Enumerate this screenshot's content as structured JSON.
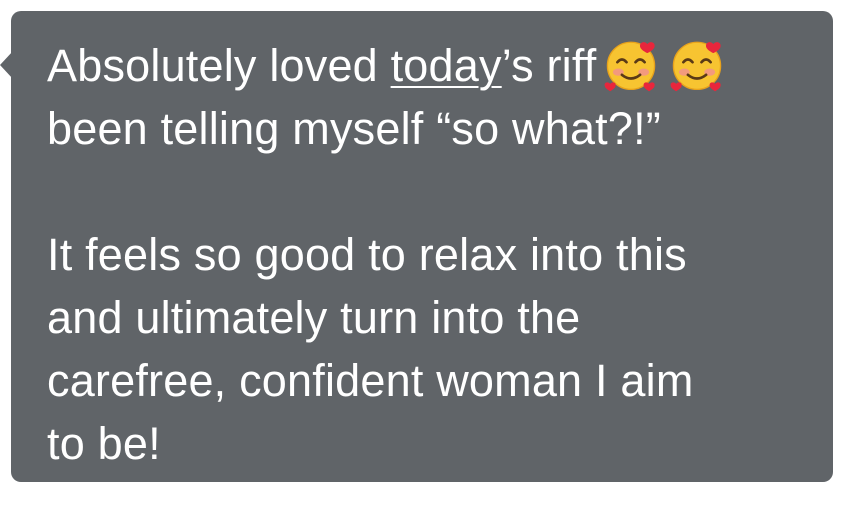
{
  "message": {
    "line1_pre": "Absolutely loved ",
    "line1_link": "today",
    "line1_post": "’s riff",
    "emojis": [
      "smiling-face-with-hearts-icon",
      "smiling-face-with-hearts-icon"
    ],
    "line2": "been telling myself “so what?!”",
    "line3": "It feels so good to relax into this",
    "line4": "and ultimately turn into the",
    "line5": "carefree, confident woman I aim",
    "line6": "to be!"
  },
  "colors": {
    "bubble": "#606468",
    "text": "#ffffff",
    "background": "#ffffff"
  }
}
